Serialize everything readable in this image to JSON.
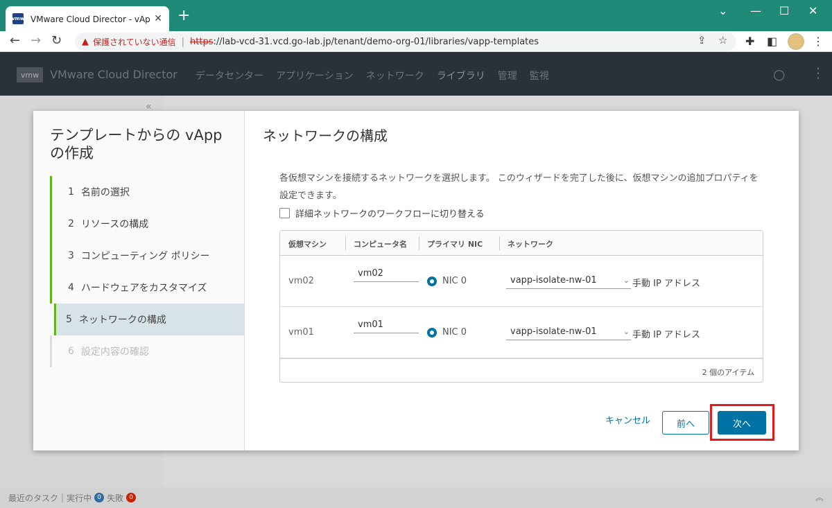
{
  "browser": {
    "tab_title": "VMware Cloud Director - vApp テ",
    "favicon_text": "vmw",
    "security_warning": "保護されていない通信",
    "url_scheme": "https",
    "url_rest": "://lab-vcd-31.vcd.go-lab.jp/tenant/demo-org-01/libraries/vapp-templates"
  },
  "app": {
    "logo": "vmw",
    "title": "VMware Cloud Director",
    "nav": [
      "データセンター",
      "アプリケーション",
      "ネットワーク",
      "ライブラリ",
      "管理",
      "監視"
    ],
    "active_nav": "ライブラリ"
  },
  "wizard": {
    "title": "テンプレートからの vApp の作成",
    "steps": [
      {
        "num": "1",
        "label": "名前の選択",
        "state": "done"
      },
      {
        "num": "2",
        "label": "リソースの構成",
        "state": "done"
      },
      {
        "num": "3",
        "label": "コンピューティング ポリシー",
        "state": "done"
      },
      {
        "num": "4",
        "label": "ハードウェアをカスタマイズ",
        "state": "done"
      },
      {
        "num": "5",
        "label": "ネットワークの構成",
        "state": "current"
      },
      {
        "num": "6",
        "label": "設定内容の確認",
        "state": "disabled"
      }
    ],
    "page_title": "ネットワークの構成",
    "description": "各仮想マシンを接続するネットワークを選択します。 このウィザードを完了した後に、仮想マシンの追加プロパティを設定できます。",
    "advanced_checkbox_label": "詳細ネットワークのワークフローに切り替える",
    "columns": [
      "仮想マシン",
      "コンピュータ名",
      "プライマリ NIC",
      "ネットワーク"
    ],
    "rows": [
      {
        "vm": "vm02",
        "computer_name": "vm02",
        "nic": "NIC 0",
        "network": "vapp-isolate-nw-01",
        "ip_mode": "手動 IP アドレス"
      },
      {
        "vm": "vm01",
        "computer_name": "vm01",
        "nic": "NIC 0",
        "network": "vapp-isolate-nw-01",
        "ip_mode": "手動 IP アドレス"
      }
    ],
    "item_count": "2 個のアイテム",
    "buttons": {
      "cancel": "キャンセル",
      "prev": "前へ",
      "next": "次へ"
    }
  },
  "taskbar": {
    "recent_tasks": "最近のタスク",
    "running": "実行中",
    "running_count": "0",
    "failed": "失敗",
    "failed_count": "0"
  },
  "colors": {
    "accent": "#0072a3",
    "progress": "#60b515",
    "highlight": "#e21a1a"
  }
}
